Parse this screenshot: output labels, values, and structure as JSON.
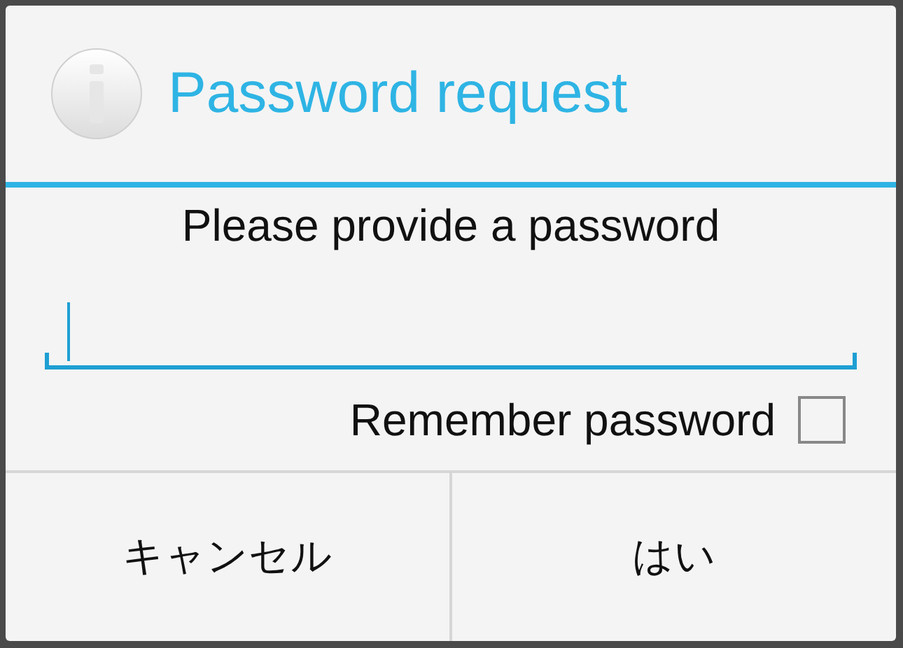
{
  "dialog": {
    "title": "Password request",
    "message": "Please provide a password",
    "remember": {
      "label": "Remember password",
      "checked": false
    },
    "buttons": [
      {
        "label": "キャンセル"
      },
      {
        "label": "はい"
      }
    ]
  }
}
